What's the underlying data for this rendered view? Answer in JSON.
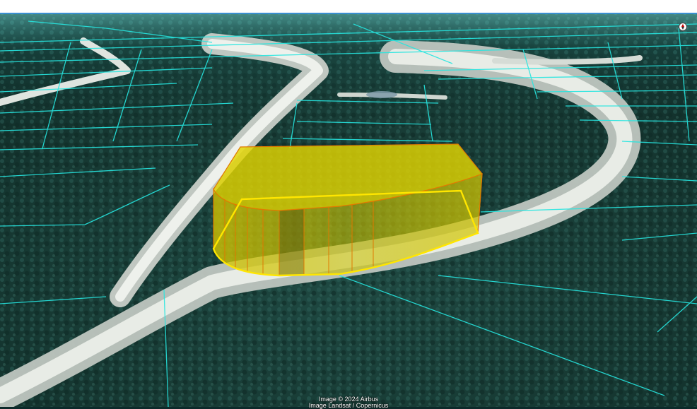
{
  "viewer": {
    "attribution_line1": "Image © 2024 Airbus",
    "attribution_line2": "Image Landsat / Copernicus"
  },
  "overlay": {
    "parcel_line_color": "#26e6e0",
    "extruded_polygon_fill": "#e2d400",
    "extruded_polygon_edge": "#e07a00",
    "polygon_outline_color": "#ffe600"
  },
  "icons": {
    "compass": "compass-icon"
  }
}
